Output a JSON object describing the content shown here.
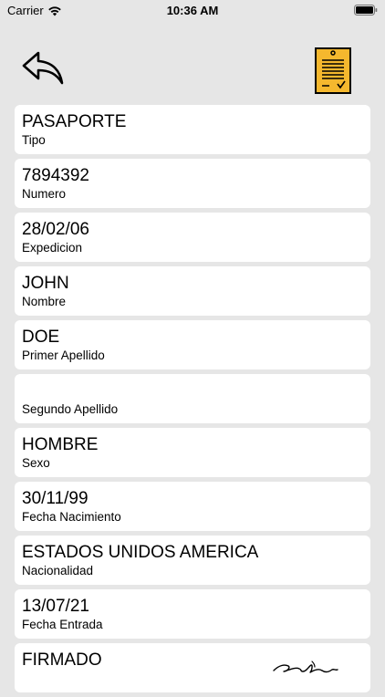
{
  "status_bar": {
    "carrier": "Carrier",
    "time": "10:36 AM"
  },
  "nav": {
    "back_icon": "reply-arrow-icon",
    "document_icon": "document-check-icon",
    "document_color": "#f5b82e"
  },
  "fields": [
    {
      "value": "PASAPORTE",
      "label": "Tipo"
    },
    {
      "value": "7894392",
      "label": "Numero"
    },
    {
      "value": "28/02/06",
      "label": "Expedicion"
    },
    {
      "value": "JOHN",
      "label": "Nombre"
    },
    {
      "value": "DOE",
      "label": "Primer Apellido"
    },
    {
      "value": "",
      "label": "Segundo Apellido"
    },
    {
      "value": "HOMBRE",
      "label": "Sexo"
    },
    {
      "value": "30/11/99",
      "label": "Fecha Nacimiento"
    },
    {
      "value": "ESTADOS UNIDOS AMERICA",
      "label": "Nacionalidad"
    },
    {
      "value": "13/07/21",
      "label": "Fecha Entrada"
    },
    {
      "value": "FIRMADO",
      "label": ""
    }
  ]
}
